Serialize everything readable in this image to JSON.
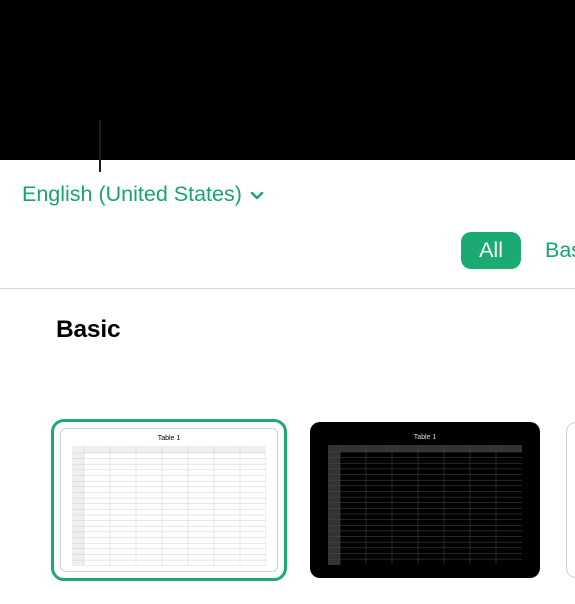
{
  "language": {
    "label": "English (United States)"
  },
  "filters": {
    "all": "All",
    "basic": "Basic"
  },
  "section": {
    "title": "Basic"
  },
  "templates": [
    {
      "label": "Table 1",
      "theme": "light",
      "selected": true
    },
    {
      "label": "Table 1",
      "theme": "dark",
      "selected": false
    }
  ],
  "colors": {
    "accent": "#1bab72"
  }
}
